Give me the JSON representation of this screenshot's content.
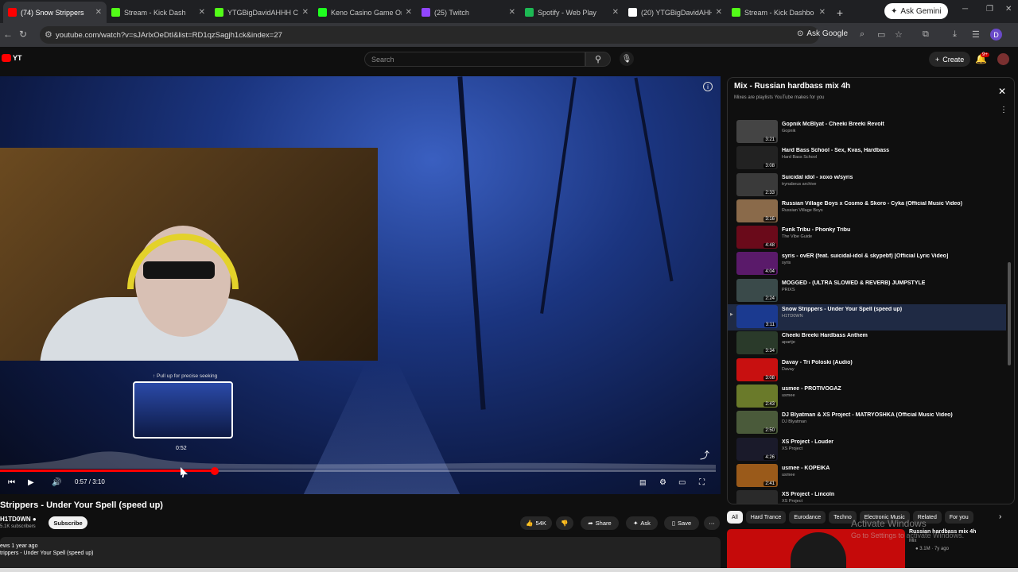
{
  "browser": {
    "tabs": [
      {
        "title": "(74) Snow Strippers",
        "icon": "youtube-icon",
        "color": "#ff0000",
        "active": true
      },
      {
        "title": "Stream - Kick Dash",
        "icon": "kick-icon",
        "color": "#53fc18"
      },
      {
        "title": "YTGBigDavidAHHH Cl",
        "icon": "kick-icon",
        "color": "#53fc18"
      },
      {
        "title": "Keno Casino Game On",
        "icon": "stake-icon",
        "color": "#1fff20"
      },
      {
        "title": "(25) Twitch",
        "icon": "twitch-icon",
        "color": "#9146ff"
      },
      {
        "title": "Spotify - Web Play",
        "icon": "spotify-icon",
        "color": "#1db954"
      },
      {
        "title": "(20) YTGBigDavidAHH",
        "icon": "x-icon",
        "color": "#ffffff"
      },
      {
        "title": "Stream - Kick Dashbo",
        "icon": "kick-icon",
        "color": "#53fc18"
      }
    ],
    "new_tab": "+",
    "gemini_label": "Ask Gemini",
    "url": "youtube.com/watch?v=sJArlxOeDtI&list=RD1qzSagjh1ck&index=27",
    "ask_google": "Ask Google",
    "profile_initial": "D"
  },
  "youtube": {
    "search_placeholder": "Search",
    "create_label": "Create",
    "notif_count": "9+"
  },
  "player": {
    "seek_hint": "↑ Pull up for precise seeking",
    "preview_time": "0:52",
    "time_display": "0:57 / 3:10",
    "progress_fraction": 0.3,
    "hover_fraction": 0.273
  },
  "video": {
    "title": "Strippers - Under Your Spell (speed up)",
    "channel": "H1TD0WN ●",
    "subscribers": "5.1K subscribers",
    "subscribe_label": "Subscribe",
    "likes": "54K",
    "share_label": "Share",
    "ask_label": "Ask",
    "save_label": "Save",
    "desc_meta": "ews  1 year ago",
    "desc_text": "trippers - Under Your Spell (speed up)"
  },
  "playlist": {
    "title": "Mix - Russian hardbass mix 4h",
    "subtitle": "Mixes are playlists YouTube makes for you",
    "items": [
      {
        "title": "Gopnik McBlyat - Cheeki Breeki Revolt",
        "channel": "Gopnik",
        "duration": "3:21",
        "color": "#444"
      },
      {
        "title": "Hard Bass School - Sex, Kvas, Hardbass",
        "channel": "Hard Bass School",
        "duration": "3:08",
        "color": "#222"
      },
      {
        "title": "Suicidal idol - xoxo w/syris",
        "channel": "trynabeus archive",
        "duration": "2:33",
        "color": "#3a3a3a"
      },
      {
        "title": "Russian Village Boys x Cosmo & Skoro - Cyka (Official Music Video)",
        "channel": "Russian Village Boys",
        "duration": "3:16",
        "color": "#8a6a4a"
      },
      {
        "title": "Funk Tribu - Phonky Tribu",
        "channel": "The Vibe Guide",
        "duration": "4:48",
        "color": "#6a0a1a"
      },
      {
        "title": "syris - ovER (feat. suicidal-idol & skypebf) [Official Lyric Video]",
        "channel": "syris",
        "duration": "4:04",
        "color": "#5a1a6a"
      },
      {
        "title": "MOGGED - (ULTRA SLOWED & REVERB) JUMPSTYLE",
        "channel": "PRIXS",
        "duration": "2:24",
        "color": "#3a4a4a"
      },
      {
        "title": "Snow Strippers - Under Your Spell (speed up)",
        "channel": "H1TD0WN",
        "duration": "3:11",
        "color": "#1b3a90",
        "active": true
      },
      {
        "title": "Cheeki Breeki Hardbass Anthem",
        "channel": "apartje",
        "duration": "3:34",
        "color": "#2a3a2a"
      },
      {
        "title": "Davay - Tri Poloski (Audio)",
        "channel": "Davay",
        "duration": "3:08",
        "color": "#c81010"
      },
      {
        "title": "usmee - PROTIVOGAZ",
        "channel": "usmee",
        "duration": "2:43",
        "color": "#6a7a2a"
      },
      {
        "title": "DJ Blyatman & XS Project - MATRYOSHKA (Official Music Video)",
        "channel": "DJ Blyatman",
        "duration": "2:50",
        "color": "#4a5a3a"
      },
      {
        "title": "XS Project - Louder",
        "channel": "XS Project",
        "duration": "4:26",
        "color": "#1a1a2a"
      },
      {
        "title": "usmee - KOPEIKA",
        "channel": "usmee",
        "duration": "2:41",
        "color": "#9a5a1a"
      },
      {
        "title": "XS Project - Lincoln",
        "channel": "XS Project",
        "duration": "",
        "color": "#2a2a2a"
      }
    ]
  },
  "chips": [
    "All",
    "Hard Trance",
    "Eurodance",
    "Techno",
    "Electronic Music",
    "Related",
    "For you"
  ],
  "recommended": {
    "title": "Russian hardbass mix 4h",
    "meta1": "Mix",
    "meta2": "● 3.1M · 7y ago"
  },
  "windows_watermark": {
    "line1": "Activate Windows",
    "line2": "Go to Settings to activate Windows."
  }
}
